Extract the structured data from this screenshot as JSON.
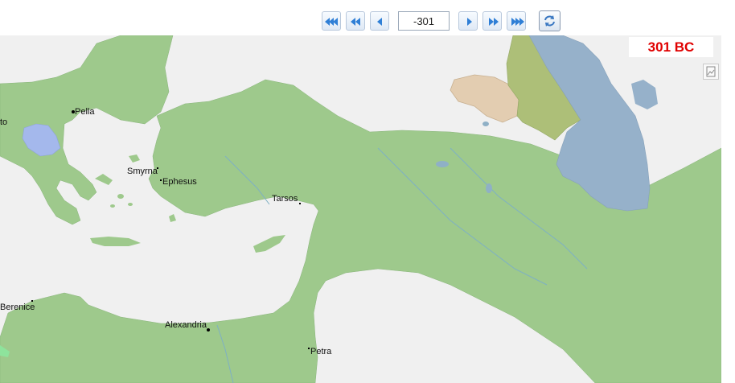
{
  "toolbar": {
    "year_value": "-301",
    "buttons": [
      {
        "name": "first-button",
        "icon": "triple-left-arrow-icon"
      },
      {
        "name": "rewind-button",
        "icon": "double-left-arrow-icon"
      },
      {
        "name": "previous-button",
        "icon": "left-arrow-icon"
      },
      {
        "name": "next-button",
        "icon": "right-arrow-icon"
      },
      {
        "name": "fast-forward-button",
        "icon": "double-right-arrow-icon"
      },
      {
        "name": "last-button",
        "icon": "triple-right-arrow-icon"
      }
    ],
    "sync_icon": "refresh-icon"
  },
  "map": {
    "year_label": "301 BC",
    "side_tool_icon": "image-icon",
    "cities": {
      "pella": "Pella",
      "smyrna": "Smyrna",
      "ephesus": "Ephesus",
      "tarsos": "Tarsos",
      "alexandria": "Alexandria",
      "petra": "Petra",
      "berenice": "Berenice",
      "edge_city": "to"
    },
    "colors": {
      "land": "#9ec98c",
      "background": "#f0f0f0",
      "sea": "#f0f0f0",
      "caspian": "#96b1ca",
      "macedon_lake": "#a4b8ec",
      "scythian_region": "#e3cdb1",
      "sarmatian_region": "#adbf78",
      "year_text": "#e00000"
    }
  }
}
